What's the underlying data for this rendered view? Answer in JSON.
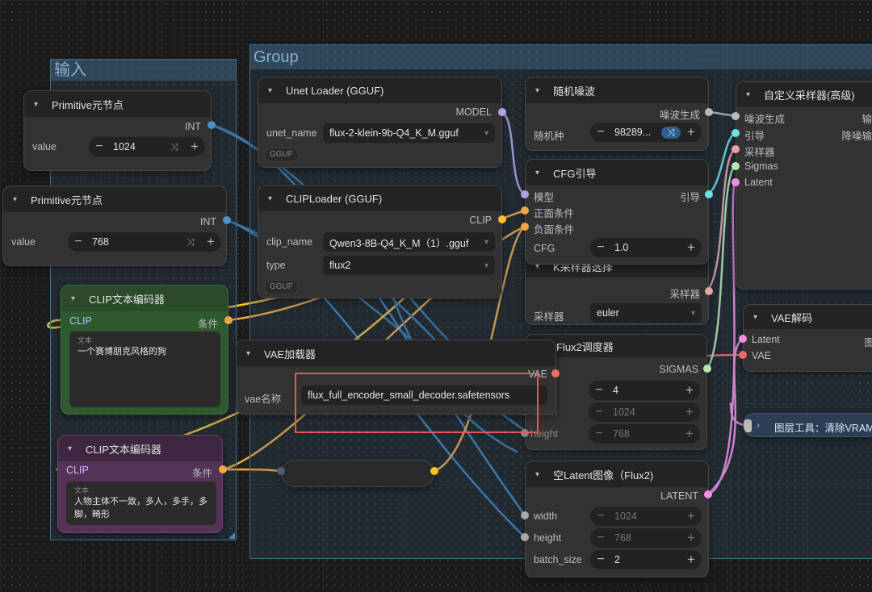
{
  "groups": {
    "input": "输入",
    "main": "Group"
  },
  "prim1": {
    "title": "Primitive元节点",
    "out": "INT",
    "label": "value",
    "value": "1024"
  },
  "prim2": {
    "title": "Primitive元节点",
    "out": "INT",
    "label": "value",
    "value": "768"
  },
  "clip_pos": {
    "title": "CLIP文本编码器",
    "in": "CLIP",
    "out": "条件",
    "hint": "文本",
    "text": "一个赛博朋克风格的狗"
  },
  "clip_neg": {
    "title": "CLIP文本编码器",
    "in": "CLIP",
    "out": "条件",
    "hint": "文本",
    "text": "人物主体不一致，多人，多手，多脚，畸形"
  },
  "unet": {
    "title": "Unet Loader (GGUF)",
    "out": "MODEL",
    "label": "unet_name",
    "value": "flux-2-klein-9b-Q4_K_M.gguf",
    "badge": "GGUF"
  },
  "cliploader": {
    "title": "CLIPLoader (GGUF)",
    "out": "CLIP",
    "name_label": "clip_name",
    "name_value": "Qwen3-8B-Q4_K_M（1）.gguf",
    "type_label": "type",
    "type_value": "flux2",
    "badge": "GGUF"
  },
  "vae_loader": {
    "title": "VAE加载器",
    "out": "VAE",
    "label": "vae名称",
    "value": "flux_full_encoder_small_decoder.safetensors"
  },
  "noise": {
    "title": "随机噪波",
    "out": "噪波生成",
    "label": "随机种",
    "value": "98289..."
  },
  "cfg": {
    "title": "CFG引导",
    "in_model": "模型",
    "in_pos": "正面条件",
    "in_neg": "负面条件",
    "out": "引导",
    "label": "CFG",
    "value": "1.0"
  },
  "ksampler": {
    "title": "K采样器选择",
    "out": "采样器",
    "label": "采样器",
    "value": "euler"
  },
  "flux2sched": {
    "title": "Flux2调度器",
    "out": "SIGMAS",
    "steps_value": "4",
    "width_label": "width",
    "width_value": "1024",
    "height_label": "height",
    "height_value": "768"
  },
  "latent": {
    "title": "空Latent图像（Flux2)",
    "out": "LATENT",
    "width_label": "width",
    "width_value": "1024",
    "height_label": "height",
    "height_value": "768",
    "batch_label": "batch_size",
    "batch_value": "2"
  },
  "custom_sampler": {
    "title": "自定义采样器(高级)",
    "in_noise": "噪波生成",
    "in_guider": "引导",
    "in_sampler": "采样器",
    "in_sigmas": "Sigmas",
    "in_latent": "Latent",
    "out1": "输",
    "out2": "降噪输"
  },
  "vae_decode": {
    "title": "VAE解码",
    "in_latent": "Latent",
    "in_vae": "VAE",
    "out": "图"
  },
  "layer_tool": {
    "title": "图层工具：清除VRAM"
  },
  "colors": {
    "int": "#4a90c8",
    "model": "#b7a0e0",
    "clip": "#f2c230",
    "conditioning": "#f5a640",
    "vae": "#f06a6a",
    "latent": "#f58ee0",
    "sigmas": "#b8e8b0",
    "guider": "#6fe0e6",
    "sampler": "#e8a3a3",
    "noise": "#b9b9b9"
  }
}
